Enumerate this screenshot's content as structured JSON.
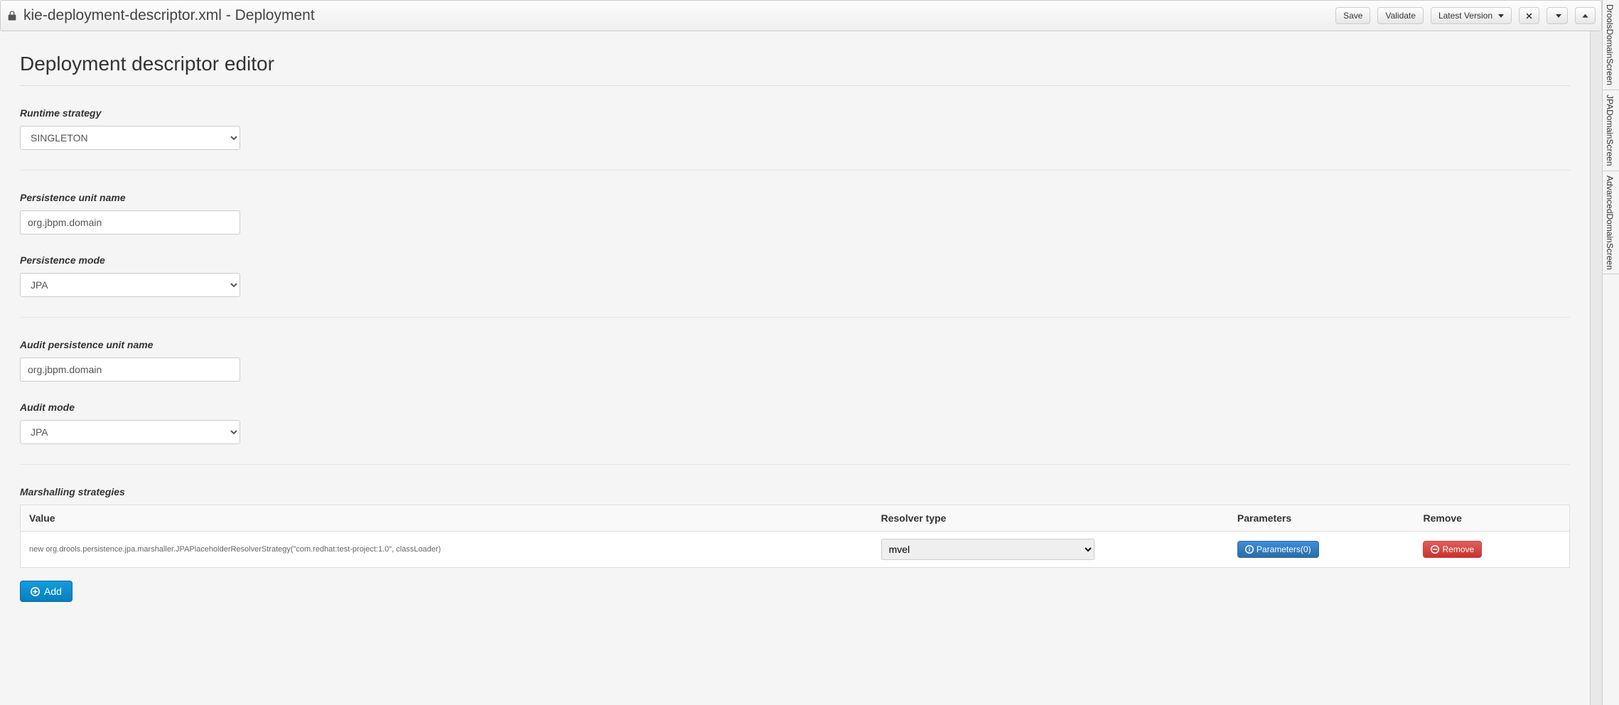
{
  "header": {
    "tab_title": "kie-deployment-descriptor.xml - Deployment",
    "save_label": "Save",
    "validate_label": "Validate",
    "latest_version_label": "Latest Version"
  },
  "right_dock": {
    "tabs": [
      "DroolsDomainScreen",
      "JPADomainScreen",
      "AdvancedDomainScreen"
    ]
  },
  "page": {
    "title": "Deployment descriptor editor"
  },
  "form": {
    "runtime_strategy": {
      "label": "Runtime strategy",
      "value": "SINGLETON"
    },
    "persistence_unit_name": {
      "label": "Persistence unit name",
      "value": "org.jbpm.domain"
    },
    "persistence_mode": {
      "label": "Persistence mode",
      "value": "JPA"
    },
    "audit_persistence_unit_name": {
      "label": "Audit persistence unit name",
      "value": "org.jbpm.domain"
    },
    "audit_mode": {
      "label": "Audit mode",
      "value": "JPA"
    }
  },
  "marshalling": {
    "section_label": "Marshalling strategies",
    "columns": {
      "value": "Value",
      "resolver": "Resolver type",
      "parameters": "Parameters",
      "remove": "Remove"
    },
    "rows": [
      {
        "value": "new org.drools.persistence.jpa.marshaller.JPAPlaceholderResolverStrategy(\"com.redhat:test-project:1.0\", classLoader)",
        "resolver": "mvel",
        "parameters_label": "Parameters(0)",
        "remove_label": "Remove"
      }
    ],
    "add_label": "Add"
  }
}
